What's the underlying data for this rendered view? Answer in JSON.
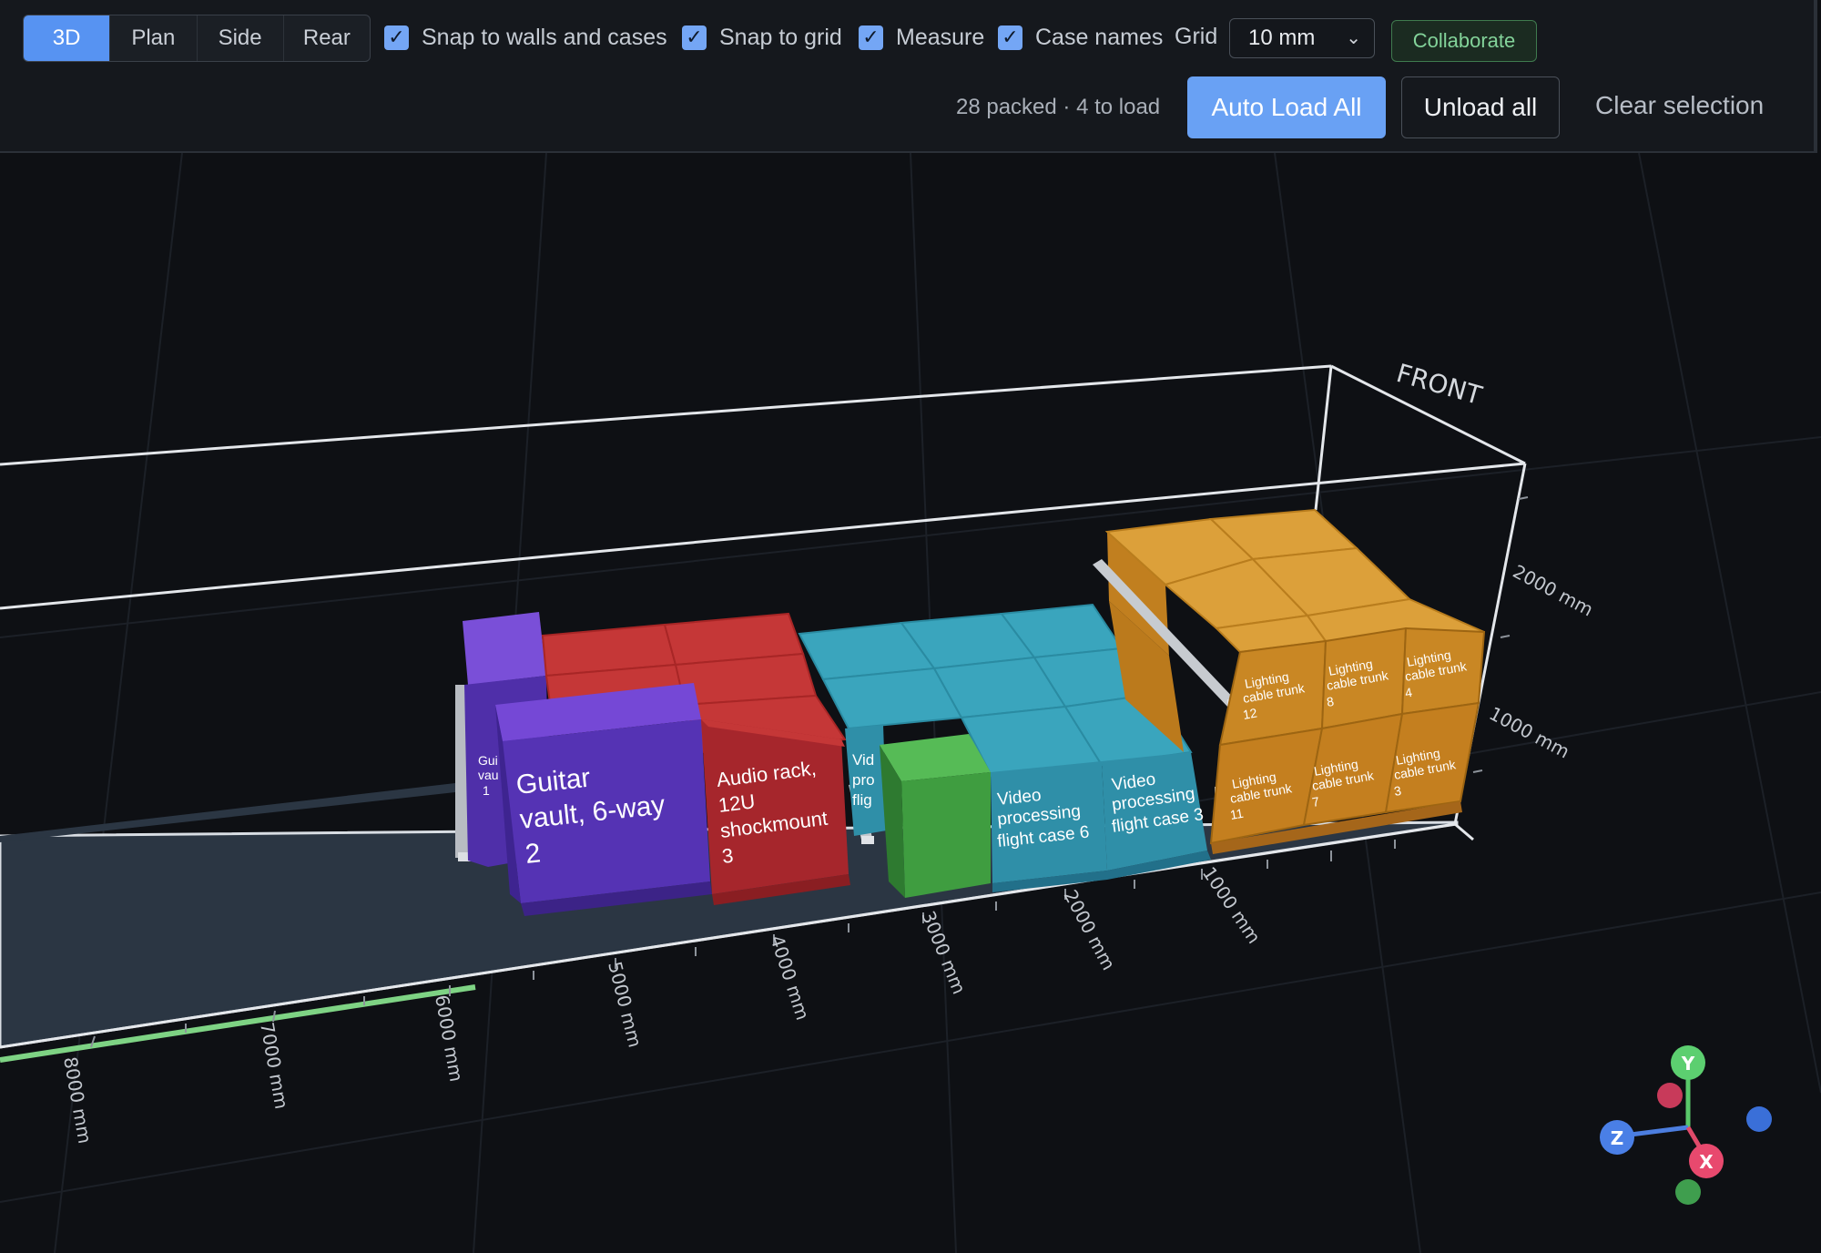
{
  "view_modes": [
    {
      "label": "3D",
      "active": true
    },
    {
      "label": "Plan",
      "active": false
    },
    {
      "label": "Side",
      "active": false
    },
    {
      "label": "Rear",
      "active": false
    }
  ],
  "options": {
    "snap_walls": "Snap to walls and cases",
    "snap_grid": "Snap to grid",
    "measure": "Measure",
    "case_names": "Case names"
  },
  "grid": {
    "label": "Grid",
    "value": "10 mm"
  },
  "collaborate_label": "Collaborate",
  "status": "28 packed · 4 to load",
  "auto_load_label": "Auto Load All",
  "unload_label": "Unload all",
  "clear_label": "Clear selection",
  "scene": {
    "front_label": "FRONT",
    "cases": {
      "guitar_2": [
        "Guitar",
        "vault, 6-way",
        "2"
      ],
      "guitar_1": [
        "Gui",
        "vau",
        "1"
      ],
      "audio_3": [
        "Audio rack,",
        "12U",
        "shockmount",
        "3"
      ],
      "video_partial": [
        "Vid",
        "pro",
        "flig"
      ],
      "video_6": [
        "Video",
        "processing",
        "flight case 6"
      ],
      "video_3": [
        "Video",
        "processing",
        "flight case 3"
      ],
      "lt12": [
        "Lighting",
        "cable trunk",
        "12"
      ],
      "lt8": [
        "Lighting",
        "cable trunk",
        "8"
      ],
      "lt4": [
        "Lighting",
        "cable trunk",
        "4"
      ],
      "lt11": [
        "Lighting",
        "cable trunk",
        "11"
      ],
      "lt7": [
        "Lighting",
        "cable trunk",
        "7"
      ],
      "lt3": [
        "Lighting",
        "cable trunk",
        "3"
      ]
    },
    "length_ticks": [
      "8000 mm",
      "7000 mm",
      "6000 mm",
      "5000 mm",
      "4000 mm",
      "3000 mm",
      "2000 mm",
      "1000 mm"
    ],
    "width_ticks": [
      "2000 mm",
      "1000 mm"
    ],
    "axes": {
      "y": "Y",
      "z": "Z",
      "x": "X"
    },
    "colors": {
      "purple": "#6a3fc9",
      "red": "#c73131",
      "teal": "#3aa0b8",
      "green": "#4cad4c",
      "orange": "#d99228"
    }
  }
}
